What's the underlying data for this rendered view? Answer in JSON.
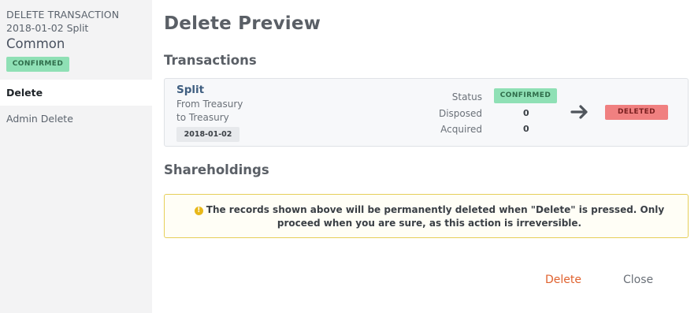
{
  "sidebar": {
    "kicker": "DELETE TRANSACTION",
    "subtitle": "2018-01-02 Split",
    "title": "Common",
    "status_badge": "CONFIRMED",
    "menu": [
      {
        "label": "Delete",
        "active": true
      },
      {
        "label": "Admin Delete",
        "active": false
      }
    ]
  },
  "main": {
    "page_title": "Delete Preview",
    "transactions_heading": "Transactions",
    "shareholdings_heading": "Shareholdings",
    "transaction": {
      "name": "Split",
      "from": "From Treasury",
      "to": "to Treasury",
      "date": "2018-01-02",
      "status_label": "Status",
      "status_value": "CONFIRMED",
      "disposed_label": "Disposed",
      "disposed_value": "0",
      "acquired_label": "Acquired",
      "acquired_value": "0",
      "new_status": "DELETED"
    },
    "warning": "The records shown above will be permanently deleted when \"Delete\" is pressed. Only proceed when you are sure, as this action is irreversible.",
    "buttons": {
      "delete": "Delete",
      "close": "Close"
    }
  },
  "colors": {
    "confirmed": "#8fe0b5",
    "deleted": "#f08080",
    "danger_text": "#e0622f",
    "warning_border": "#e6cf5a"
  }
}
